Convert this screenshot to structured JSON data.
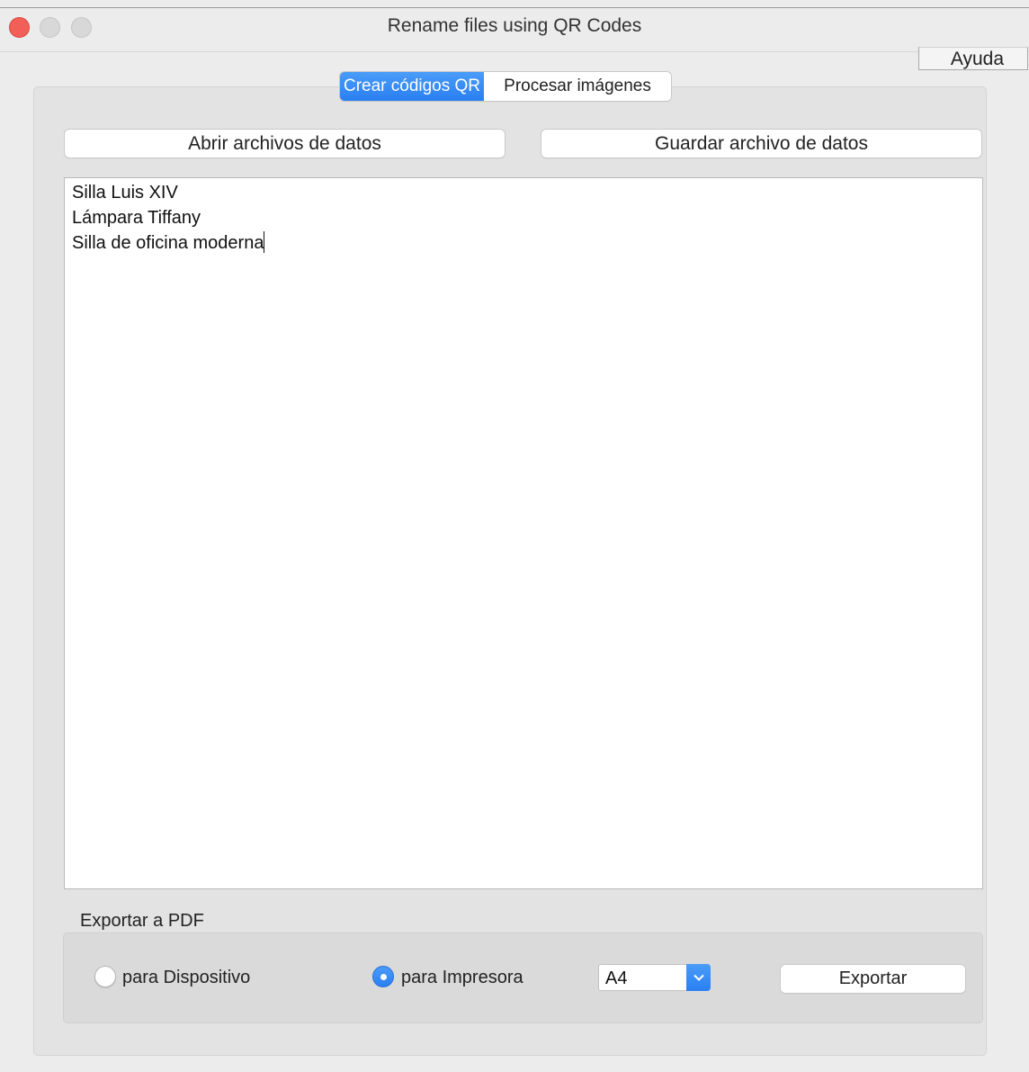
{
  "window": {
    "title": "Rename files using QR Codes"
  },
  "toolbar": {
    "help_label": "Ayuda"
  },
  "tabs": [
    {
      "label": "Crear códigos QR",
      "active": true
    },
    {
      "label": "Procesar imágenes",
      "active": false
    }
  ],
  "data_buttons": {
    "open_label": "Abrir archivos de datos",
    "save_label": "Guardar archivo de datos"
  },
  "editor": {
    "lines": [
      "Silla Luis XIV",
      "Lámpara Tiffany",
      "Silla de oficina moderna"
    ]
  },
  "export": {
    "section_label": "Exportar a PDF",
    "options": [
      {
        "label": "para Dispositivo",
        "selected": false
      },
      {
        "label": "para Impresora",
        "selected": true
      }
    ],
    "paper_size": "A4",
    "export_label": "Exportar"
  },
  "colors": {
    "accent": "#2a7ff2",
    "close": "#f25f58"
  },
  "icons": {
    "dropdown": "chevron-down-icon"
  }
}
